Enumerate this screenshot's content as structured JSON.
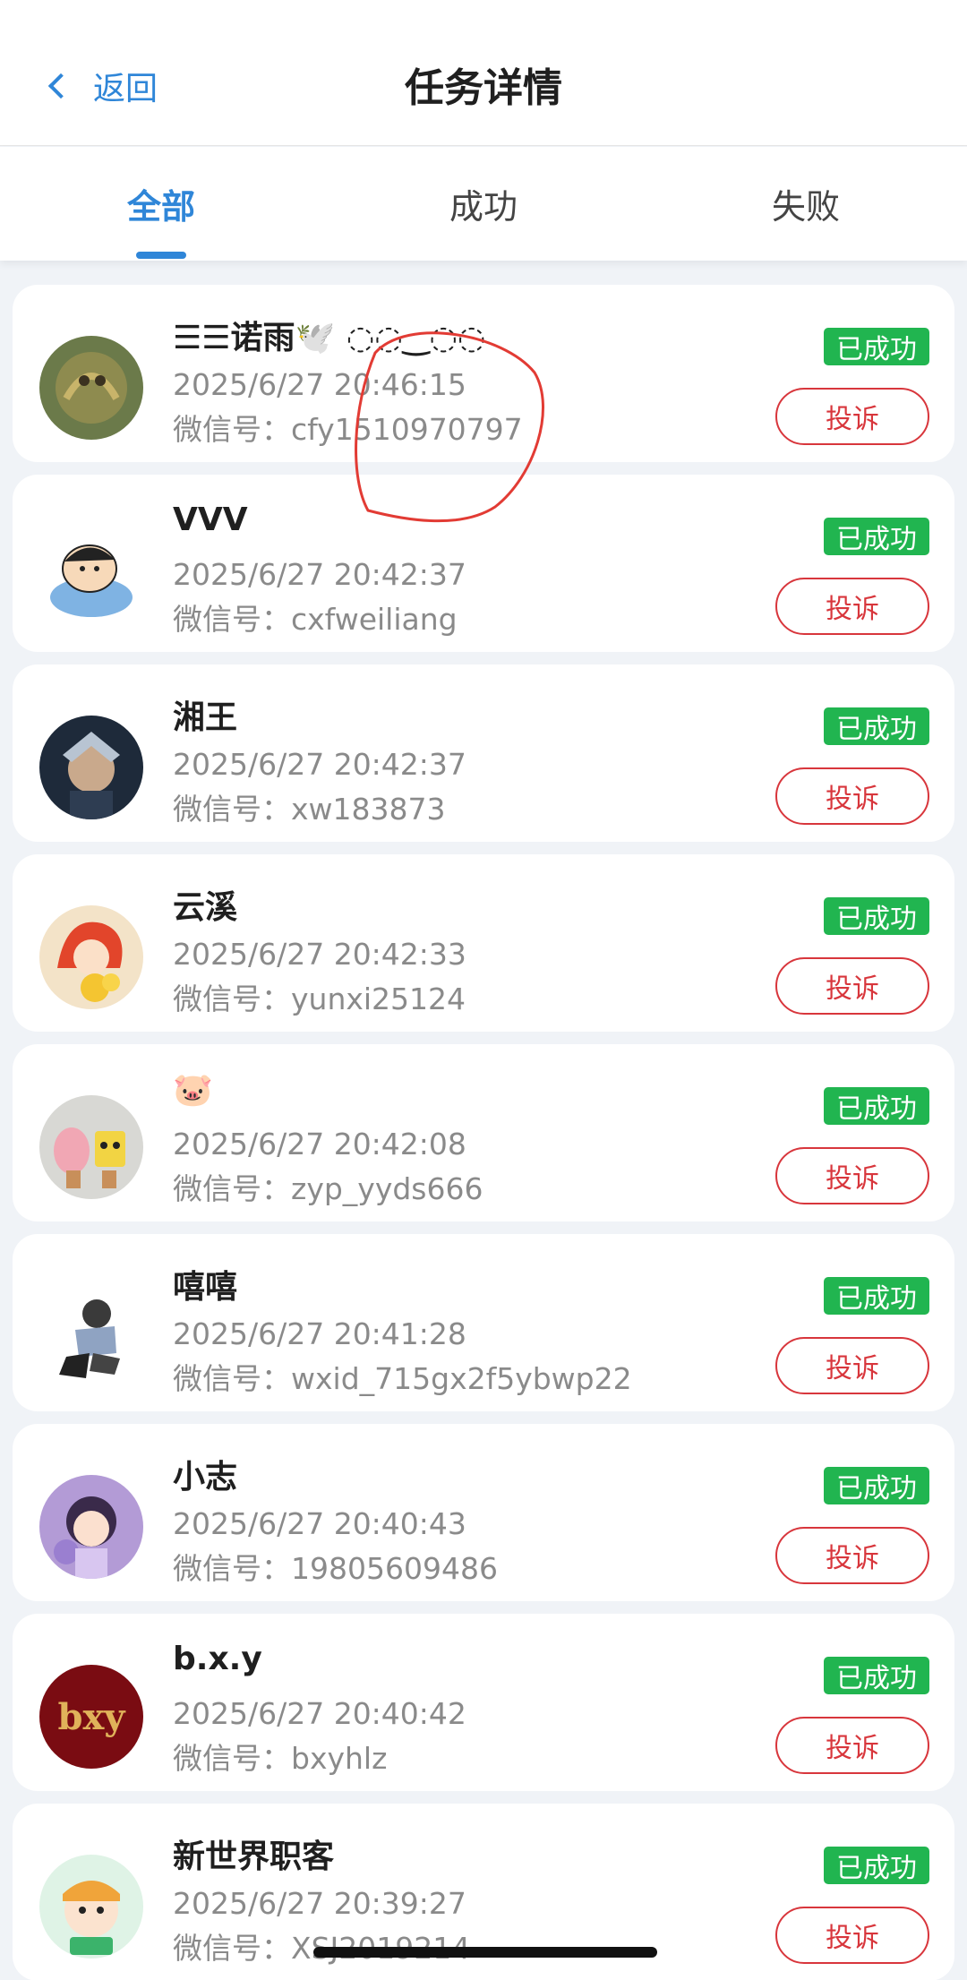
{
  "header": {
    "back_label": "返回",
    "title": "任务详情"
  },
  "tabs": [
    {
      "label": "全部",
      "active": true
    },
    {
      "label": "成功",
      "active": false
    },
    {
      "label": "失败",
      "active": false
    }
  ],
  "records": [
    {
      "name": "☰☰诺雨🕊️ ◌◌‿◌◌ ",
      "time": "2025/6/27 20:46:15",
      "wechat_label": "微信号：",
      "wechat": "cfy1510970797",
      "status": "已成功",
      "complain": "投诉"
    },
    {
      "name": "VVV",
      "time": "2025/6/27 20:42:37",
      "wechat_label": "微信号：",
      "wechat": "cxfweiliang",
      "status": "已成功",
      "complain": "投诉"
    },
    {
      "name": "湘王",
      "time": "2025/6/27 20:42:37",
      "wechat_label": "微信号：",
      "wechat": "xw183873",
      "status": "已成功",
      "complain": "投诉"
    },
    {
      "name": "云溪",
      "time": "2025/6/27 20:42:33",
      "wechat_label": "微信号：",
      "wechat": "yunxi25124",
      "status": "已成功",
      "complain": "投诉"
    },
    {
      "name": "🐷",
      "time": "2025/6/27 20:42:08",
      "wechat_label": "微信号：",
      "wechat": "zyp_yyds666",
      "status": "已成功",
      "complain": "投诉"
    },
    {
      "name": "嘻嘻",
      "time": "2025/6/27 20:41:28",
      "wechat_label": "微信号：",
      "wechat": "wxid_715gx2f5ybwp22",
      "status": "已成功",
      "complain": "投诉"
    },
    {
      "name": "小志",
      "time": "2025/6/27 20:40:43",
      "wechat_label": "微信号：",
      "wechat": "19805609486",
      "status": "已成功",
      "complain": "投诉"
    },
    {
      "name": "b.x.y",
      "time": "2025/6/27 20:40:42",
      "wechat_label": "微信号：",
      "wechat": "bxyhlz",
      "status": "已成功",
      "complain": "投诉",
      "avatar_text": "bxy"
    },
    {
      "name": "新世界职客",
      "time": "2025/6/27 20:39:27",
      "wechat_label": "微信号：",
      "wechat": "XSJ2019214",
      "status": "已成功",
      "complain": "投诉"
    }
  ],
  "colors": {
    "accent": "#2f86d8",
    "success": "#21b550",
    "danger": "#d8363c",
    "background": "#f0f3f7"
  }
}
